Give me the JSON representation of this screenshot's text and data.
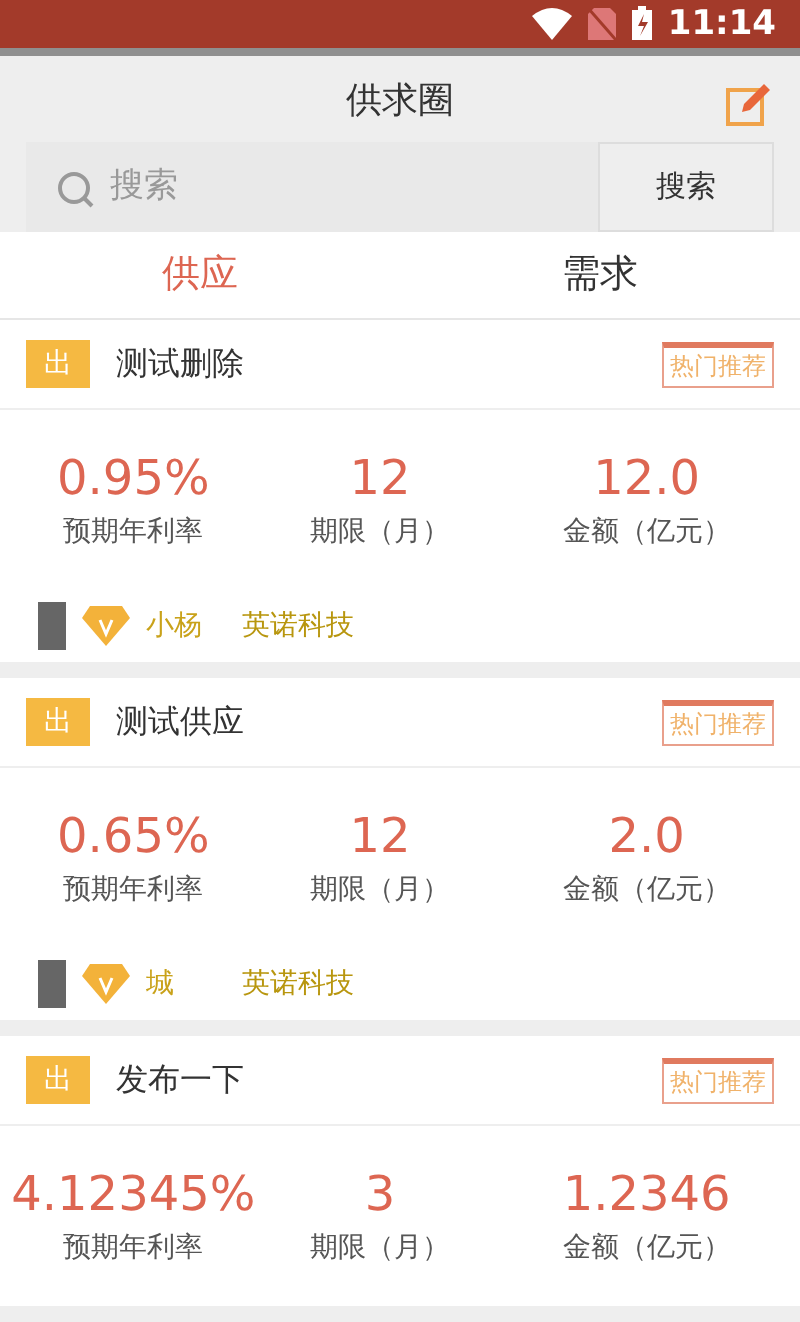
{
  "status_bar": {
    "time": "11:14"
  },
  "header": {
    "title": "供求圈"
  },
  "search": {
    "placeholder": "搜索",
    "button": "搜索"
  },
  "tabs": [
    {
      "label": "供应",
      "selected": true
    },
    {
      "label": "需求",
      "selected": false
    }
  ],
  "cards": [
    {
      "badge": "出",
      "title": "测试删除",
      "tag": "热门推荐",
      "stats": [
        {
          "value": "0.95%",
          "label": "预期年利率"
        },
        {
          "value": "12",
          "label": "期限（月）"
        },
        {
          "value": "12.0",
          "label": "金额（亿元）"
        }
      ],
      "footer": {
        "user": "小杨",
        "company": "英诺科技"
      }
    },
    {
      "badge": "出",
      "title": "测试供应",
      "tag": "热门推荐",
      "stats": [
        {
          "value": "0.65%",
          "label": "预期年利率"
        },
        {
          "value": "12",
          "label": "期限（月）"
        },
        {
          "value": "2.0",
          "label": "金额（亿元）"
        }
      ],
      "footer": {
        "user": "城",
        "company": "英诺科技"
      }
    },
    {
      "badge": "出",
      "title": "发布一下",
      "tag": "热门推荐",
      "stats": [
        {
          "value": "4.12345%",
          "label": "预期年利率"
        },
        {
          "value": "3",
          "label": "期限（月）"
        },
        {
          "value": "1.2346",
          "label": "金额（亿元）"
        }
      ]
    }
  ]
}
